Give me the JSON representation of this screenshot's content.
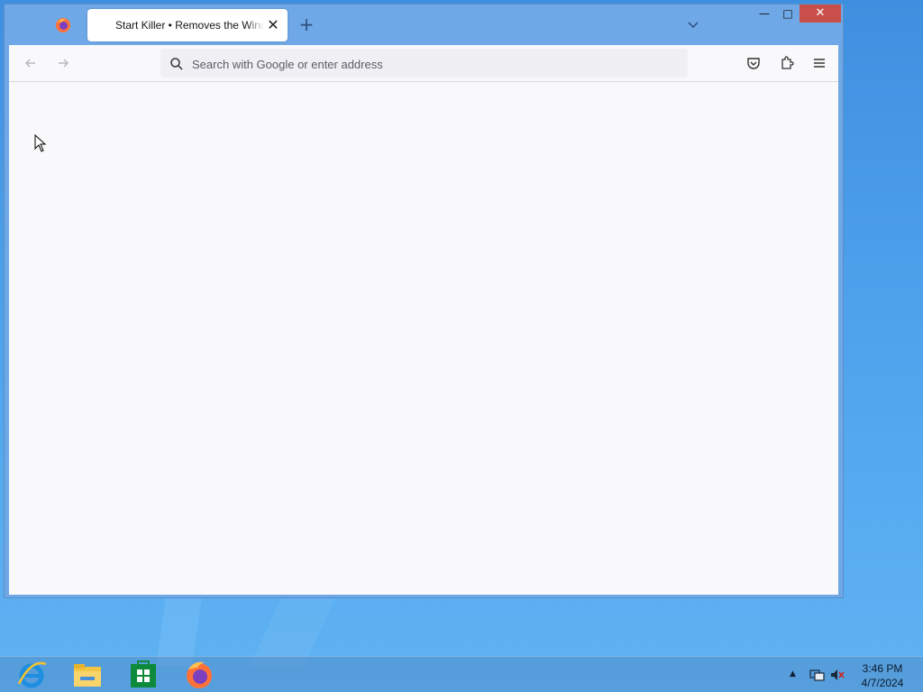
{
  "browser": {
    "tab": {
      "title": "Start Killer • Removes the Windows Start button",
      "close_glyph": "✕"
    },
    "new_tab_glyph": "+",
    "tabs_list_icon": "chevron-down-icon",
    "window_controls": {
      "minimize_glyph": "—",
      "maximize_glyph": "□",
      "close_glyph": "✕"
    },
    "navbar": {
      "back_icon": "arrow-left-icon",
      "forward_icon": "arrow-right-icon",
      "search_placeholder": "Search with Google or enter address",
      "search_value": "",
      "pocket_icon": "pocket-icon",
      "extensions_icon": "puzzle-icon",
      "menu_icon": "hamburger-menu-icon"
    }
  },
  "taskbar": {
    "apps": [
      {
        "name": "Internet Explorer",
        "icon": "ie-icon"
      },
      {
        "name": "File Explorer",
        "icon": "folder-icon"
      },
      {
        "name": "Store",
        "icon": "store-icon"
      },
      {
        "name": "Firefox",
        "icon": "firefox-icon"
      }
    ],
    "tray": {
      "overflow_glyph": "▲",
      "network_icon": "network-icon",
      "volume_icon": "volume-muted-icon"
    },
    "clock": {
      "time": "3:46 PM",
      "date": "4/7/2024"
    }
  },
  "colors": {
    "desktop": "#4ea2ec",
    "titlebar": "#6fa8e6",
    "close_button": "#c9504a",
    "content_bg": "#f9f9fb"
  }
}
